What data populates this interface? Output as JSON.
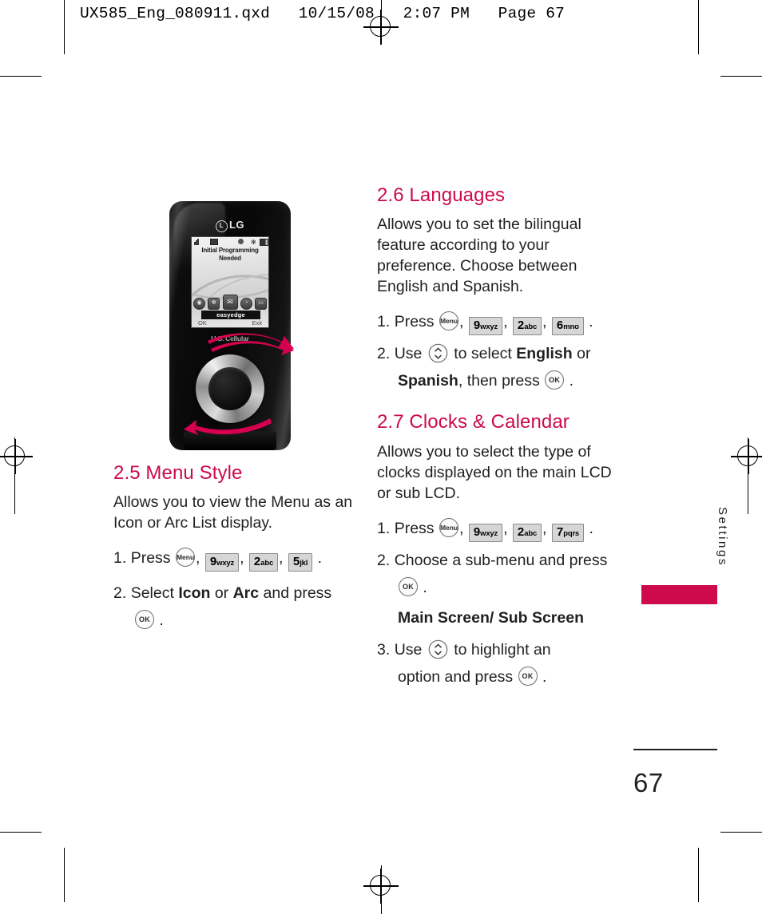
{
  "print_slug": "UX585_Eng_080911.qxd   10/15/08   2:07 PM   Page 67",
  "folio": {
    "page_number": "67",
    "side_tab_label": "Settings",
    "accent_color": "#cc0a4c"
  },
  "phone_illustration": {
    "brand": "LG",
    "screen": {
      "banner_line_1": "Initial Programming",
      "banner_line_2": "Needed",
      "dock_label": "easyedge",
      "softkey_left": "OK",
      "softkey_right": "Exit",
      "dock_icons": [
        "camera-icon",
        "bluetooth-icon",
        "messaging-icon",
        "alarm-clock-icon",
        "voicemail-icon"
      ],
      "status_icons": [
        "signal-icon",
        "message-icon",
        "alarm-icon",
        "bluetooth-icon",
        "battery-icon"
      ]
    },
    "carrier": "U.S. Cellular"
  },
  "sections": [
    {
      "id": "2.5",
      "heading": "2.5 Menu Style",
      "column": "left",
      "intro": "Allows you to view the Menu as an Icon or Arc List display.",
      "steps": [
        {
          "number": "1.",
          "lead": "Press",
          "keys": [
            {
              "type": "round",
              "label": "Menu"
            },
            {
              "type": "square",
              "digit": "9",
              "letters": "wxyz"
            },
            {
              "type": "square",
              "digit": "2",
              "letters": "abc"
            },
            {
              "type": "square",
              "digit": "5",
              "letters": "jkl"
            }
          ],
          "trailing": "."
        },
        {
          "number": "2.",
          "text_before": "Select ",
          "bold_1": "Icon",
          "text_middle": " or ",
          "bold_2": "Arc",
          "text_after": " and press",
          "keys": [
            {
              "type": "round",
              "label": "OK"
            }
          ],
          "trailing": "."
        }
      ]
    },
    {
      "id": "2.6",
      "heading": "2.6 Languages",
      "column": "right",
      "intro": "Allows you to set the bilingual feature according to your preference. Choose between English and Spanish.",
      "steps": [
        {
          "number": "1.",
          "lead": "Press",
          "keys": [
            {
              "type": "round",
              "label": "Menu"
            },
            {
              "type": "square",
              "digit": "9",
              "letters": "wxyz"
            },
            {
              "type": "square",
              "digit": "2",
              "letters": "abc"
            },
            {
              "type": "square",
              "digit": "6",
              "letters": "mno"
            }
          ],
          "trailing": "."
        },
        {
          "number": "2.",
          "lead": "Use",
          "nav_key": "up-down-navigation-key",
          "text_before": "to select ",
          "bold_1": "English",
          "text_middle": " or",
          "bold_2": "Spanish",
          "text_after": ", then press",
          "keys": [
            {
              "type": "round",
              "label": "OK"
            }
          ],
          "trailing": "."
        }
      ]
    },
    {
      "id": "2.7",
      "heading": "2.7 Clocks & Calendar",
      "column": "right",
      "intro": "Allows you to select the type of clocks displayed on the main LCD or sub LCD.",
      "steps": [
        {
          "number": "1.",
          "lead": "Press",
          "keys": [
            {
              "type": "round",
              "label": "Menu"
            },
            {
              "type": "square",
              "digit": "9",
              "letters": "wxyz"
            },
            {
              "type": "square",
              "digit": "2",
              "letters": "abc"
            },
            {
              "type": "square",
              "digit": "7",
              "letters": "pqrs"
            }
          ],
          "trailing": "."
        },
        {
          "number": "2.",
          "text_before": "Choose a sub-menu and press",
          "keys": [
            {
              "type": "round",
              "label": "OK"
            }
          ],
          "trailing": ".",
          "note": "Main Screen/ Sub Screen"
        },
        {
          "number": "3.",
          "lead": "Use",
          "nav_key": "up-down-navigation-key",
          "text_before": "to highlight an",
          "text_after": "option and press",
          "keys": [
            {
              "type": "round",
              "label": "OK"
            }
          ],
          "trailing": "."
        }
      ]
    }
  ]
}
